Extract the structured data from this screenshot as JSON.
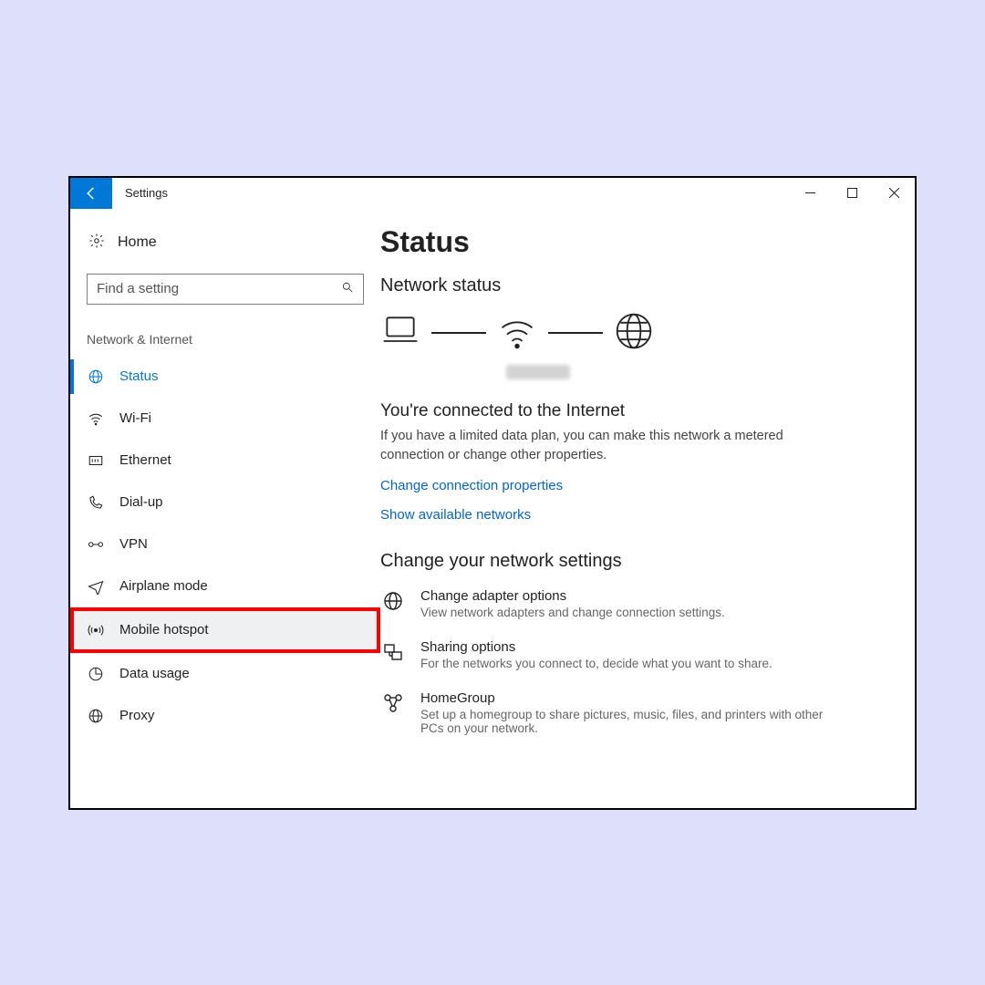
{
  "window": {
    "title": "Settings"
  },
  "sidebar": {
    "home": "Home",
    "search_placeholder": "Find a setting",
    "section": "Network & Internet",
    "items": [
      {
        "label": "Status"
      },
      {
        "label": "Wi-Fi"
      },
      {
        "label": "Ethernet"
      },
      {
        "label": "Dial-up"
      },
      {
        "label": "VPN"
      },
      {
        "label": "Airplane mode"
      },
      {
        "label": "Mobile hotspot"
      },
      {
        "label": "Data usage"
      },
      {
        "label": "Proxy"
      }
    ]
  },
  "main": {
    "title": "Status",
    "network_status_head": "Network status",
    "connected_head": "You're connected to the Internet",
    "connected_body": "If you have a limited data plan, you can make this network a metered connection or change other properties.",
    "link_change_props": "Change connection properties",
    "link_show_networks": "Show available networks",
    "change_settings_head": "Change your network settings",
    "options": [
      {
        "title": "Change adapter options",
        "desc": "View network adapters and change connection settings."
      },
      {
        "title": "Sharing options",
        "desc": "For the networks you connect to, decide what you want to share."
      },
      {
        "title": "HomeGroup",
        "desc": "Set up a homegroup to share pictures, music, files, and printers with other PCs on your network."
      }
    ]
  }
}
